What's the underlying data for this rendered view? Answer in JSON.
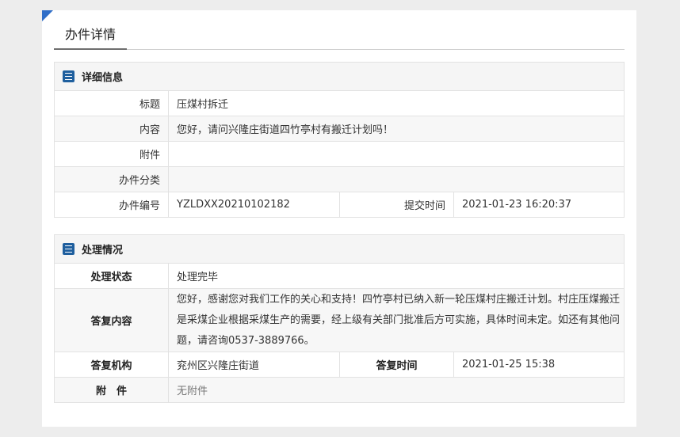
{
  "page": {
    "title": "办件详情"
  },
  "detail": {
    "header": "详细信息",
    "rows": {
      "title_label": "标题",
      "title_value": "压煤村拆迁",
      "content_label": "内容",
      "content_value": "您好，请问兴隆庄街道四竹亭村有搬迁计划吗！",
      "attach_label": "附件",
      "attach_value": "",
      "category_label": "办件分类",
      "category_value": "",
      "number_label": "办件编号",
      "number_value": "YZLDXX20210102182",
      "submit_time_label": "提交时间",
      "submit_time_value": "2021-01-23 16:20:37"
    }
  },
  "handling": {
    "header": "处理情况",
    "rows": {
      "status_label": "处理状态",
      "status_value": "处理完毕",
      "reply_label": "答复内容",
      "reply_value": "您好，感谢您对我们工作的关心和支持！四竹亭村已纳入新一轮压煤村庄搬迁计划。村庄压煤搬迁是采煤企业根据采煤生产的需要，经上级有关部门批准后方可实施，具体时间未定。如还有其他问题，请咨询0537-3889766。",
      "org_label": "答复机构",
      "org_value": "兖州区兴隆庄街道",
      "reply_time_label": "答复时间",
      "reply_time_value": "2021-01-25 15:38",
      "attach_label": "附　件",
      "attach_value": "无附件"
    }
  },
  "colors": {
    "accent": "#2f6ec8",
    "icon": "#1f5f9e"
  }
}
